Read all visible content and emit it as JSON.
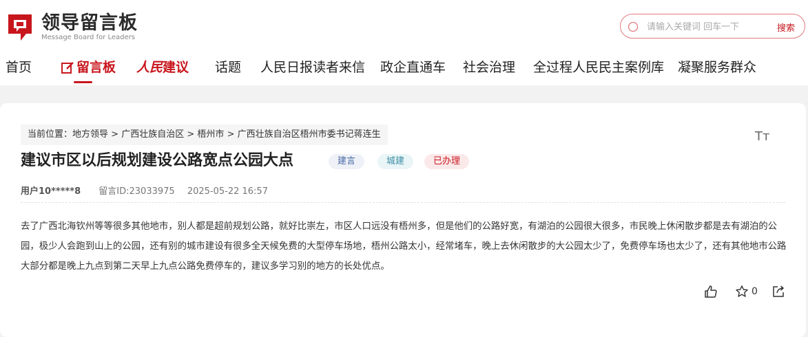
{
  "header": {
    "logo_cn": "领导留言板",
    "logo_en": "Message Board for Leaders",
    "search_placeholder": "请输入关键词 回车一下",
    "search_button": "搜索"
  },
  "nav": {
    "items": [
      "首页",
      "留言板",
      "人民",
      "建议",
      "话题",
      "人民日报读者来信",
      "政企直通车",
      "社会治理",
      "全过程人民民主案例库",
      "凝聚服务群众"
    ]
  },
  "breadcrumb": {
    "label": "当前位置：",
    "path": [
      "地方领导",
      "广西壮族自治区",
      "梧州市",
      "广西壮族自治区梧州市委书记蒋连生"
    ],
    "separator": ">"
  },
  "font_toggle": "Tт",
  "message": {
    "title": "建议市区以后规划建设公路宽点公园大点",
    "tags": [
      "建言",
      "城建",
      "已办理"
    ],
    "user": "用户10*****8",
    "message_id": "留言ID:23033975",
    "datetime": "2025-05-22 16:57",
    "body": "去了广西北海钦州等等很多其他地市，别人都是超前规划公路，就好比崇左，市区人口远没有梧州多，但是他们的公路好宽，有湖泊的公园很大很多，市民晚上休闲散步都是去有湖泊的公园，极少人会跑到山上的公园，还有别的城市建设有很多全天候免费的大型停车场地，梧州公路太小，经常堵车，晚上去休闲散步的大公园太少了，免费停车场也太少了，还有其他地市公路大部分都是晚上九点到第二天早上九点公路免费停车的，建议多学习别的地方的长处优点。",
    "star_count": "0"
  },
  "colors": {
    "brand_red": "#c8161d",
    "page_bg": "#f2f2f2"
  }
}
